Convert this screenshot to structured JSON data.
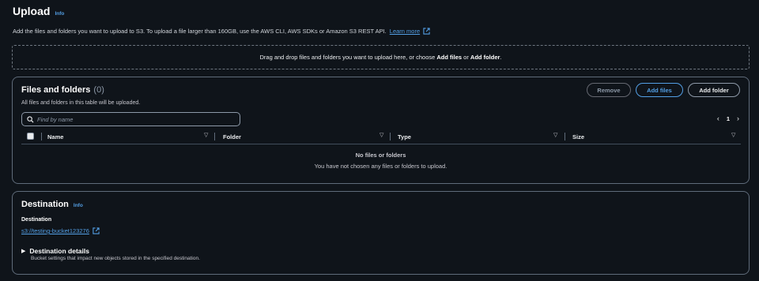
{
  "header": {
    "title": "Upload",
    "info_label": "Info",
    "description": "Add the files and folders you want to upload to S3. To upload a file larger than 160GB, use the AWS CLI, AWS SDKs or Amazon S3 REST API.",
    "learn_more": "Learn more"
  },
  "dropzone": {
    "prefix": "Drag and drop files and folders you want to upload here, or choose",
    "add_files": "Add files",
    "or": "or",
    "add_folder": "Add folder",
    "suffix": "."
  },
  "files_panel": {
    "title": "Files and folders",
    "count": "(0)",
    "subtitle": "All files and folders in this table will be uploaded.",
    "buttons": {
      "remove": "Remove",
      "add_files": "Add files",
      "add_folder": "Add folder"
    },
    "search": {
      "placeholder": "Find by name",
      "value": ""
    },
    "pagination": {
      "current_page": "1"
    },
    "columns": [
      "Name",
      "Folder",
      "Type",
      "Size"
    ],
    "empty_title": "No files or folders",
    "empty_subtitle": "You have not chosen any files or folders to upload."
  },
  "destination": {
    "title": "Destination",
    "info_label": "Info",
    "label": "Destination",
    "bucket": "s3://testing-bucket123276",
    "details_title": "Destination details",
    "details_subtitle": "Bucket settings that impact new objects stored in the specified destination."
  },
  "colors": {
    "background": "#0f141a",
    "link": "#539fe5",
    "border": "#5f6b7a"
  }
}
